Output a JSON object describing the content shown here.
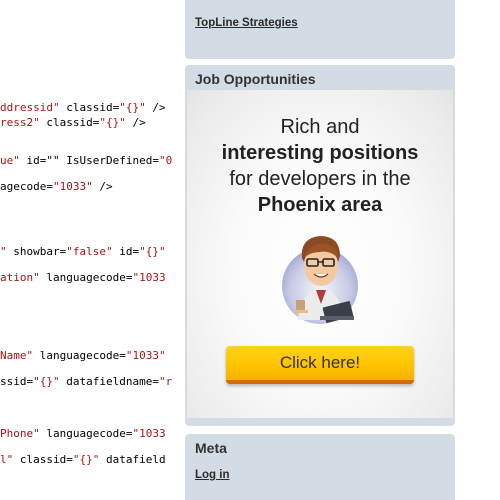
{
  "code": {
    "lines": [
      {
        "segments": [
          {
            "t": "ddressid\"",
            "c": "str"
          },
          {
            "t": " classid=",
            "c": "plain"
          },
          {
            "t": "\"{}\"",
            "c": "str"
          },
          {
            "t": " />",
            "c": "plain"
          }
        ]
      },
      {
        "segments": [
          {
            "t": "ress2\"",
            "c": "str"
          },
          {
            "t": " classid=",
            "c": "plain"
          },
          {
            "t": "\"{}\"",
            "c": "str"
          },
          {
            "t": " />",
            "c": "plain"
          }
        ]
      },
      {
        "segments": [
          {
            "t": "ue\"",
            "c": "str"
          },
          {
            "t": " id=\"\" IsUserDefined=",
            "c": "plain"
          },
          {
            "t": "\"0",
            "c": "str"
          }
        ]
      },
      {
        "segments": [
          {
            "t": "agecode=",
            "c": "plain"
          },
          {
            "t": "\"1033\"",
            "c": "str"
          },
          {
            "t": " />",
            "c": "plain"
          }
        ]
      },
      {
        "segments": [
          {
            "t": "\"",
            "c": "str"
          },
          {
            "t": " showbar=",
            "c": "plain"
          },
          {
            "t": "\"false\"",
            "c": "str"
          },
          {
            "t": " id=",
            "c": "plain"
          },
          {
            "t": "\"{}\"",
            "c": "str"
          }
        ]
      },
      {
        "segments": [
          {
            "t": "ation\"",
            "c": "str"
          },
          {
            "t": " languagecode=",
            "c": "plain"
          },
          {
            "t": "\"1033",
            "c": "str"
          }
        ]
      },
      {
        "segments": [
          {
            "t": "Name\"",
            "c": "str"
          },
          {
            "t": " languagecode=",
            "c": "plain"
          },
          {
            "t": "\"1033\"",
            "c": "str"
          }
        ]
      },
      {
        "segments": [
          {
            "t": "ssid=",
            "c": "plain"
          },
          {
            "t": "\"{}\"",
            "c": "str"
          },
          {
            "t": " datafieldname=",
            "c": "plain"
          },
          {
            "t": "\"r",
            "c": "str"
          }
        ]
      },
      {
        "segments": [
          {
            "t": "Phone\"",
            "c": "str"
          },
          {
            "t": " languagecode=",
            "c": "plain"
          },
          {
            "t": "\"1033",
            "c": "str"
          }
        ]
      },
      {
        "segments": [
          {
            "t": "l\"",
            "c": "str"
          },
          {
            "t": " classid=",
            "c": "plain"
          },
          {
            "t": "\"{}\"",
            "c": "str"
          },
          {
            "t": " datafield",
            "c": "plain"
          }
        ]
      }
    ]
  },
  "sidebar": {
    "top_widget": {
      "partial_link": "                    ",
      "link": "TopLine Strategies"
    },
    "jobs": {
      "title": "Job Opportunities",
      "ad_line1": "Rich and",
      "ad_line2": "interesting positions",
      "ad_line3": "for developers in the",
      "ad_line4": "Phoenix area",
      "button_label": "Click here!"
    },
    "meta": {
      "title": "Meta",
      "login_link": "Log in"
    }
  },
  "colors": {
    "widget_bg": "#d3dbe5",
    "button_yellow": "#ffc400",
    "button_orange": "#d66a00"
  }
}
